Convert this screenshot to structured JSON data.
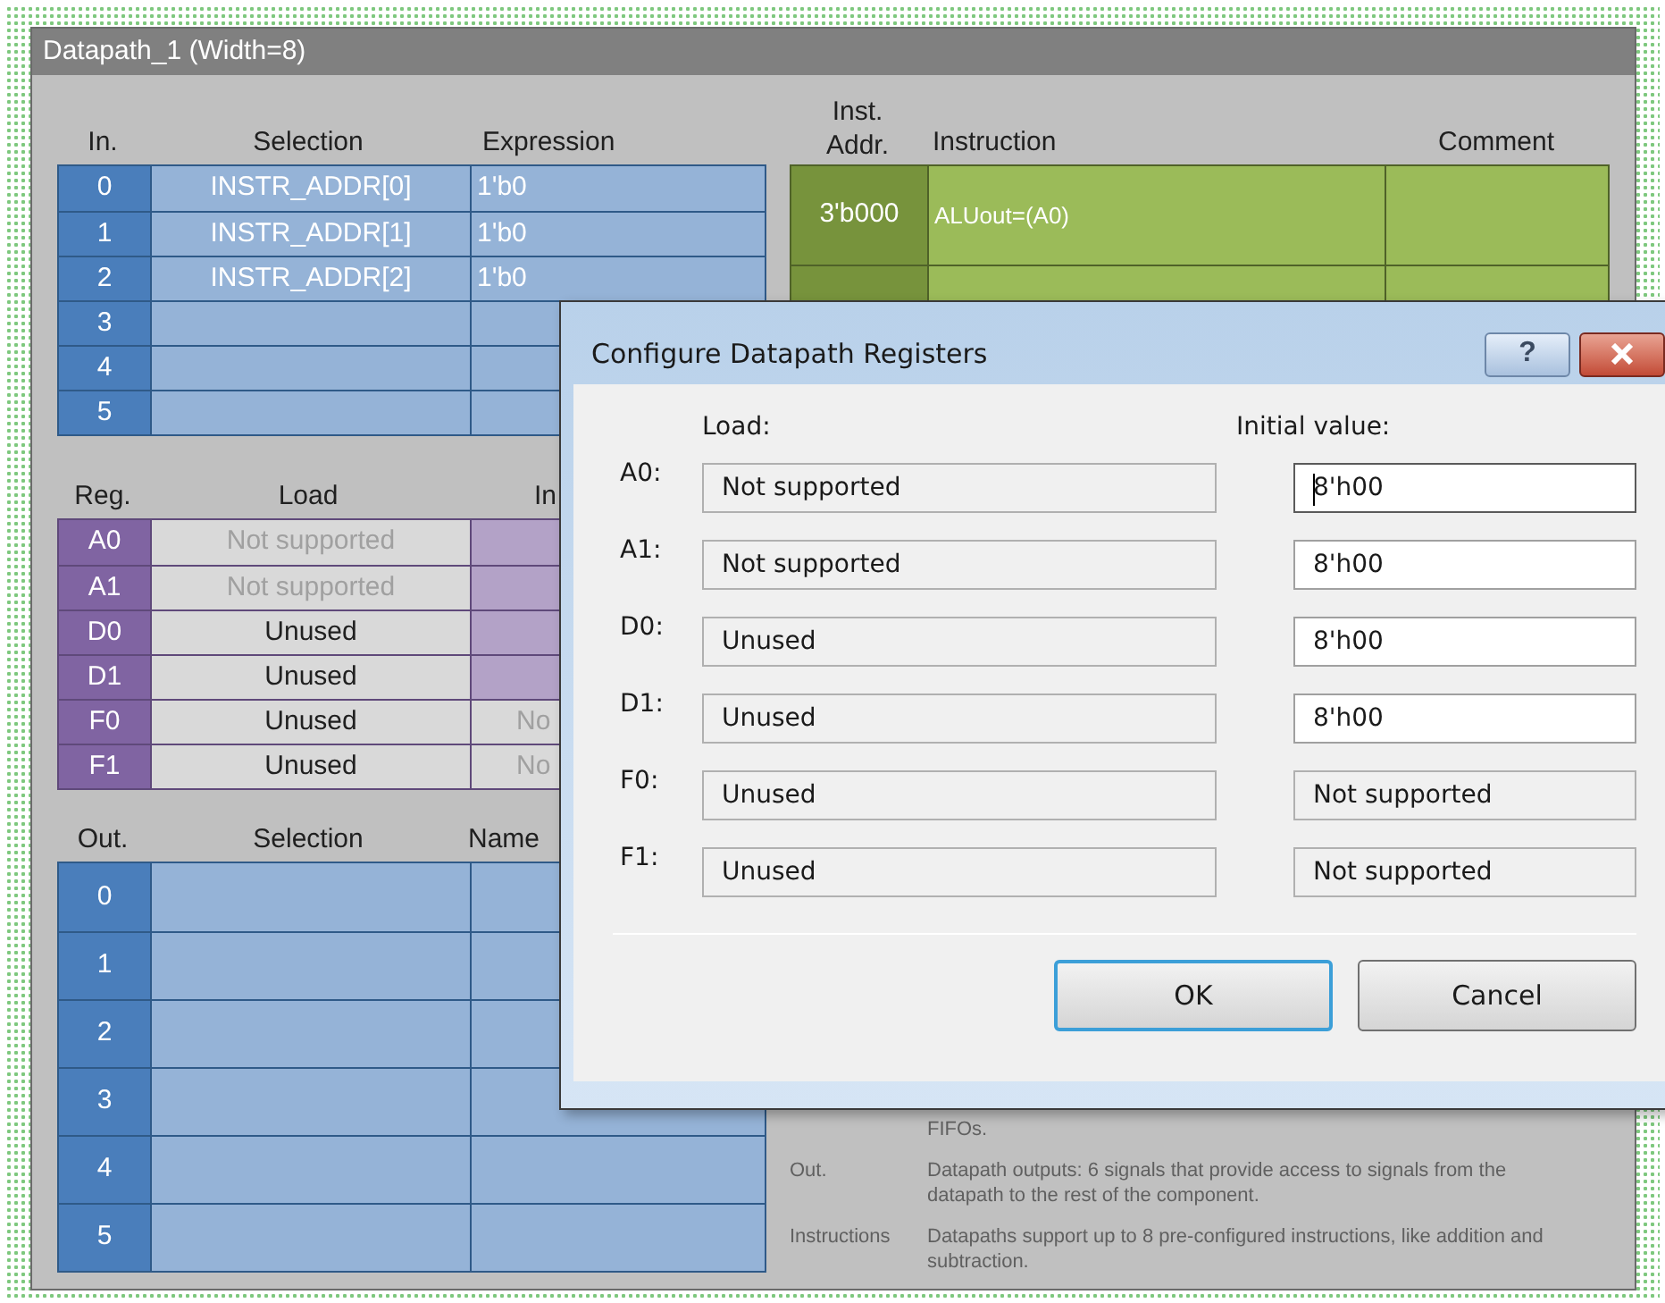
{
  "component": {
    "title": "Datapath_1 (Width=8)"
  },
  "inputs": {
    "columns": [
      "In.",
      "Selection",
      "Expression"
    ],
    "rows": [
      {
        "index": "0",
        "selection": "INSTR_ADDR[0]",
        "expression": "1'b0"
      },
      {
        "index": "1",
        "selection": "INSTR_ADDR[1]",
        "expression": "1'b0"
      },
      {
        "index": "2",
        "selection": "INSTR_ADDR[2]",
        "expression": "1'b0"
      },
      {
        "index": "3"
      },
      {
        "index": "4"
      },
      {
        "index": "5"
      }
    ]
  },
  "registers": {
    "columns": [
      "Reg.",
      "Load",
      "In"
    ],
    "rows": [
      {
        "name": "A0",
        "load": "Not supported",
        "load_disabled": true
      },
      {
        "name": "A1",
        "load": "Not supported",
        "load_disabled": true
      },
      {
        "name": "D0",
        "load": "Unused",
        "load_disabled": false
      },
      {
        "name": "D1",
        "load": "Unused",
        "load_disabled": false
      },
      {
        "name": "F0",
        "load": "Unused",
        "load_disabled": false,
        "initial": "No"
      },
      {
        "name": "F1",
        "load": "Unused",
        "load_disabled": false,
        "initial": "No"
      }
    ]
  },
  "outputs": {
    "columns": [
      "Out.",
      "Selection",
      "Name"
    ],
    "rows": [
      {
        "index": "0"
      },
      {
        "index": "1"
      },
      {
        "index": "2"
      },
      {
        "index": "3"
      },
      {
        "index": "4"
      },
      {
        "index": "5"
      }
    ]
  },
  "instructions": {
    "columns": [
      "Inst. Addr.",
      "Instruction",
      "Comment"
    ],
    "rows": [
      {
        "address": "3'b000",
        "instruction": "ALUout=(A0)"
      }
    ]
  },
  "description": [
    {
      "text": "FIFOs."
    },
    {
      "label": "Out.",
      "text": "Datapath outputs: 6 signals that provide access to signals from the datapath to the rest of the component."
    },
    {
      "label": "Instructions",
      "text": "Datapaths support up to 8 pre-configured instructions, like addition and subtraction."
    }
  ],
  "dialog": {
    "title": "Configure Datapath Registers",
    "help": "?",
    "load_header": "Load:",
    "initial_header": "Initial value:",
    "rows": [
      {
        "label": "A0:",
        "load": "Not supported",
        "initial": "8'h00",
        "initial_disabled": false,
        "focused": true
      },
      {
        "label": "A1:",
        "load": "Not supported",
        "initial": "8'h00",
        "initial_disabled": false,
        "focused": false
      },
      {
        "label": "D0:",
        "load": "Unused",
        "initial": "8'h00",
        "initial_disabled": false,
        "focused": false
      },
      {
        "label": "D1:",
        "load": "Unused",
        "initial": "8'h00",
        "initial_disabled": false,
        "focused": false
      },
      {
        "label": "F0:",
        "load": "Unused",
        "initial": "Not supported",
        "initial_disabled": true,
        "focused": false
      },
      {
        "label": "F1:",
        "load": "Unused",
        "initial": "Not supported",
        "initial_disabled": true,
        "focused": false
      }
    ],
    "buttons": [
      {
        "label": "OK",
        "default": true
      },
      {
        "label": "Cancel",
        "default": false
      }
    ]
  }
}
